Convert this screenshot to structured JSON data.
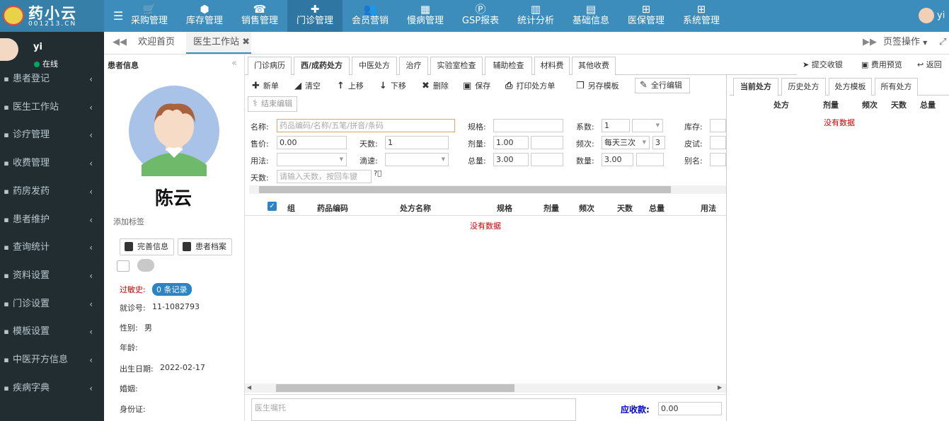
{
  "brand": {
    "name": "药小云",
    "domain": "001213.CN"
  },
  "topnav": [
    {
      "label": "采购管理",
      "icon": "cart-icon",
      "glyph": "🛒"
    },
    {
      "label": "库存管理",
      "icon": "box-icon",
      "glyph": "⬢"
    },
    {
      "label": "销售管理",
      "icon": "register-icon",
      "glyph": "☎"
    },
    {
      "label": "门诊管理",
      "icon": "medkit-icon",
      "glyph": "✚"
    },
    {
      "label": "会员营销",
      "icon": "users-icon",
      "glyph": "👥"
    },
    {
      "label": "慢病管理",
      "icon": "hospital-icon",
      "glyph": "▦"
    },
    {
      "label": "GSP报表",
      "icon": "report-icon",
      "glyph": "Ⓟ"
    },
    {
      "label": "统计分析",
      "icon": "bar-chart-icon",
      "glyph": "▥"
    },
    {
      "label": "基础信息",
      "icon": "book-icon",
      "glyph": "▤"
    },
    {
      "label": "医保管理",
      "icon": "windows-icon",
      "glyph": "⊞"
    },
    {
      "label": "系统管理",
      "icon": "windows-icon",
      "glyph": "⊞"
    }
  ],
  "user": {
    "name": "yi",
    "status": "在线"
  },
  "sidebar": [
    {
      "label": "患者登记"
    },
    {
      "label": "医生工作站"
    },
    {
      "label": "诊疗管理"
    },
    {
      "label": "收费管理"
    },
    {
      "label": "药房发药"
    },
    {
      "label": "患者维护"
    },
    {
      "label": "查询统计"
    },
    {
      "label": "资料设置"
    },
    {
      "label": "门诊设置"
    },
    {
      "label": "模板设置"
    },
    {
      "label": "中医开方信息"
    },
    {
      "label": "疾病字典"
    }
  ],
  "tabs": {
    "home": "欢迎首页",
    "workstation": "医生工作站",
    "ops": "页签操作"
  },
  "patient": {
    "section_title": "患者信息",
    "name": "陈云",
    "add_tag": "添加标签",
    "btn_complete": "完善信息",
    "btn_archive": "患者档案",
    "allergy_label": "过敏史:",
    "allergy_badge": "0 条记录",
    "visit_no_label": "就诊号:",
    "visit_no": "11-1082793",
    "gender_label": "性别:",
    "gender": "男",
    "age_label": "年龄:",
    "birth_label": "出生日期:",
    "birth": "2022-02-17",
    "marriage_label": "婚姻:",
    "id_label": "身份证:"
  },
  "subtabs": [
    "门诊病历",
    "西/成药处方",
    "中医处方",
    "治疗",
    "实验室检查",
    "辅助检查",
    "材料费",
    "其他收费"
  ],
  "actions": {
    "submit": "提交收银",
    "preview": "费用预览",
    "back": "返回"
  },
  "toolbar": {
    "new": "新单",
    "clear": "清空",
    "up": "上移",
    "down": "下移",
    "delete": "删除",
    "save": "保存",
    "print": "打印处方单",
    "save_tpl": "另存模板",
    "edit_all": "全行编辑",
    "end_edit": "结束编辑"
  },
  "form": {
    "name_label": "名称:",
    "name_ph": "药品编码/名称/五笔/拼音/条码",
    "spec_label": "规格:",
    "coef_label": "系数:",
    "coef": "1",
    "stock_label": "库存:",
    "price_label": "售价:",
    "price": "0.00",
    "days_label": "天数:",
    "days": "1",
    "dose_label": "剂量:",
    "dose": "1.00",
    "freq_label": "频次:",
    "freq": "每天三次",
    "freq_n": "3",
    "skin_label": "皮试:",
    "usage_label": "用法:",
    "drip_label": "滴速:",
    "total_label": "总量:",
    "total": "3.00",
    "qty_label": "数量:",
    "qty": "3.00",
    "alias_label": "别名:",
    "days2_label": "天数:",
    "days2_ph": "请输入天数，按回车键"
  },
  "grid": {
    "headers": [
      "组",
      "药品编码",
      "处方名称",
      "规格",
      "剂量",
      "频次",
      "天数",
      "总量",
      "用法"
    ],
    "empty": "没有数据"
  },
  "right": {
    "tabs": [
      "当前处方",
      "历史处方",
      "处方模板",
      "所有处方"
    ],
    "headers": [
      "处方",
      "剂量",
      "频次",
      "天数",
      "总量"
    ],
    "empty": "没有数据"
  },
  "bottom": {
    "advice_ph": "医生嘱托",
    "receivable_label": "应收款:",
    "receivable": "0.00"
  }
}
